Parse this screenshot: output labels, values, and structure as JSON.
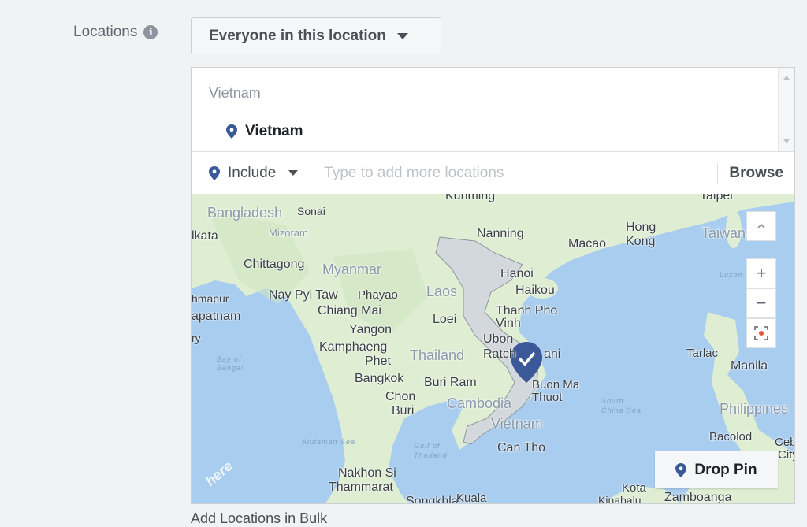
{
  "locations": {
    "label": "Locations",
    "info_icon": "i",
    "type_dropdown": "Everyone in this location"
  },
  "selected": {
    "group_label": "Vietnam",
    "items": [
      {
        "name": "Vietnam"
      }
    ]
  },
  "search": {
    "include_label": "Include",
    "placeholder": "Type to add more locations",
    "browse_label": "Browse"
  },
  "map": {
    "labels": {
      "kunming": "Kunming",
      "taipei": "Taipei",
      "bangladesh": "Bangladesh",
      "sonai": "Sonai",
      "kata": "lkata",
      "mizoram": "Mizoram",
      "nanning": "Nanning",
      "hong_kong_1": "Hong",
      "hong_kong_2": "Kong",
      "macao": "Macao",
      "taiwan": "Taiwan",
      "chittagong": "Chittagong",
      "myanmar": "Myanmar",
      "hanoi": "Hanoi",
      "haikou": "Haikou",
      "luzon_strait": "Luzon Strait",
      "hmapur": "hmapur",
      "nay_pyi_taw": "Nay Pyi Taw",
      "phayao": "Phayao",
      "laos": "Laos",
      "apatnam": "apatnam",
      "chiang_mai": "Chiang Mai",
      "thanh_pho_1": "Thanh Pho",
      "thanh_pho_2": "Vinh",
      "loei": "Loei",
      "ry": "ry",
      "yangon": "Yangon",
      "ubon": "Ubon",
      "kamphaeng_1": "Kamphaeng",
      "kamphaeng_2": "Phet",
      "thailand": "Thailand",
      "ratch": "Ratch",
      "nani": "ani",
      "bay_of_bengal_1": "Bay of",
      "bay_of_bengal_2": "Bengal",
      "tarlac": "Tarlac",
      "manila": "Manila",
      "bangkok": "Bangkok",
      "buri_ram": "Buri Ram",
      "buon_ma_1": "Buon Ma",
      "buon_ma_2": "Thuot",
      "chon_buri_1": "Chon",
      "chon_buri_2": "Buri",
      "cambodia": "Cambodia",
      "south_china_sea_1": "South",
      "south_china_sea_2": "China Sea",
      "philippines": "Philippines",
      "vietnam": "Vietnam",
      "andaman_sea": "Andaman Sea",
      "gulf_1": "Gulf of",
      "gulf_2": "Thailand",
      "can_tho": "Can Tho",
      "bacolod": "Bacolod",
      "cebu_1": "Ceb",
      "cebu_2": "City",
      "nakhon_si_1": "Nakhon Si",
      "nakhon_si_2": "Thammarat",
      "songkhla": "Songkhla",
      "kuala": "Kuala",
      "kota_1": "Kota",
      "kota_2": "Kinabalu",
      "zamboanga": "Zamboanga"
    },
    "watermark": "here",
    "zoom_in": "+",
    "zoom_out": "−",
    "drop_pin_label": "Drop Pin"
  },
  "footer": {
    "add_bulk": "Add Locations in Bulk"
  },
  "colors": {
    "water": "#a9cdee",
    "land": "#dfeed3",
    "selected_country": "#d3d8dc",
    "pin": "#3b5998"
  }
}
